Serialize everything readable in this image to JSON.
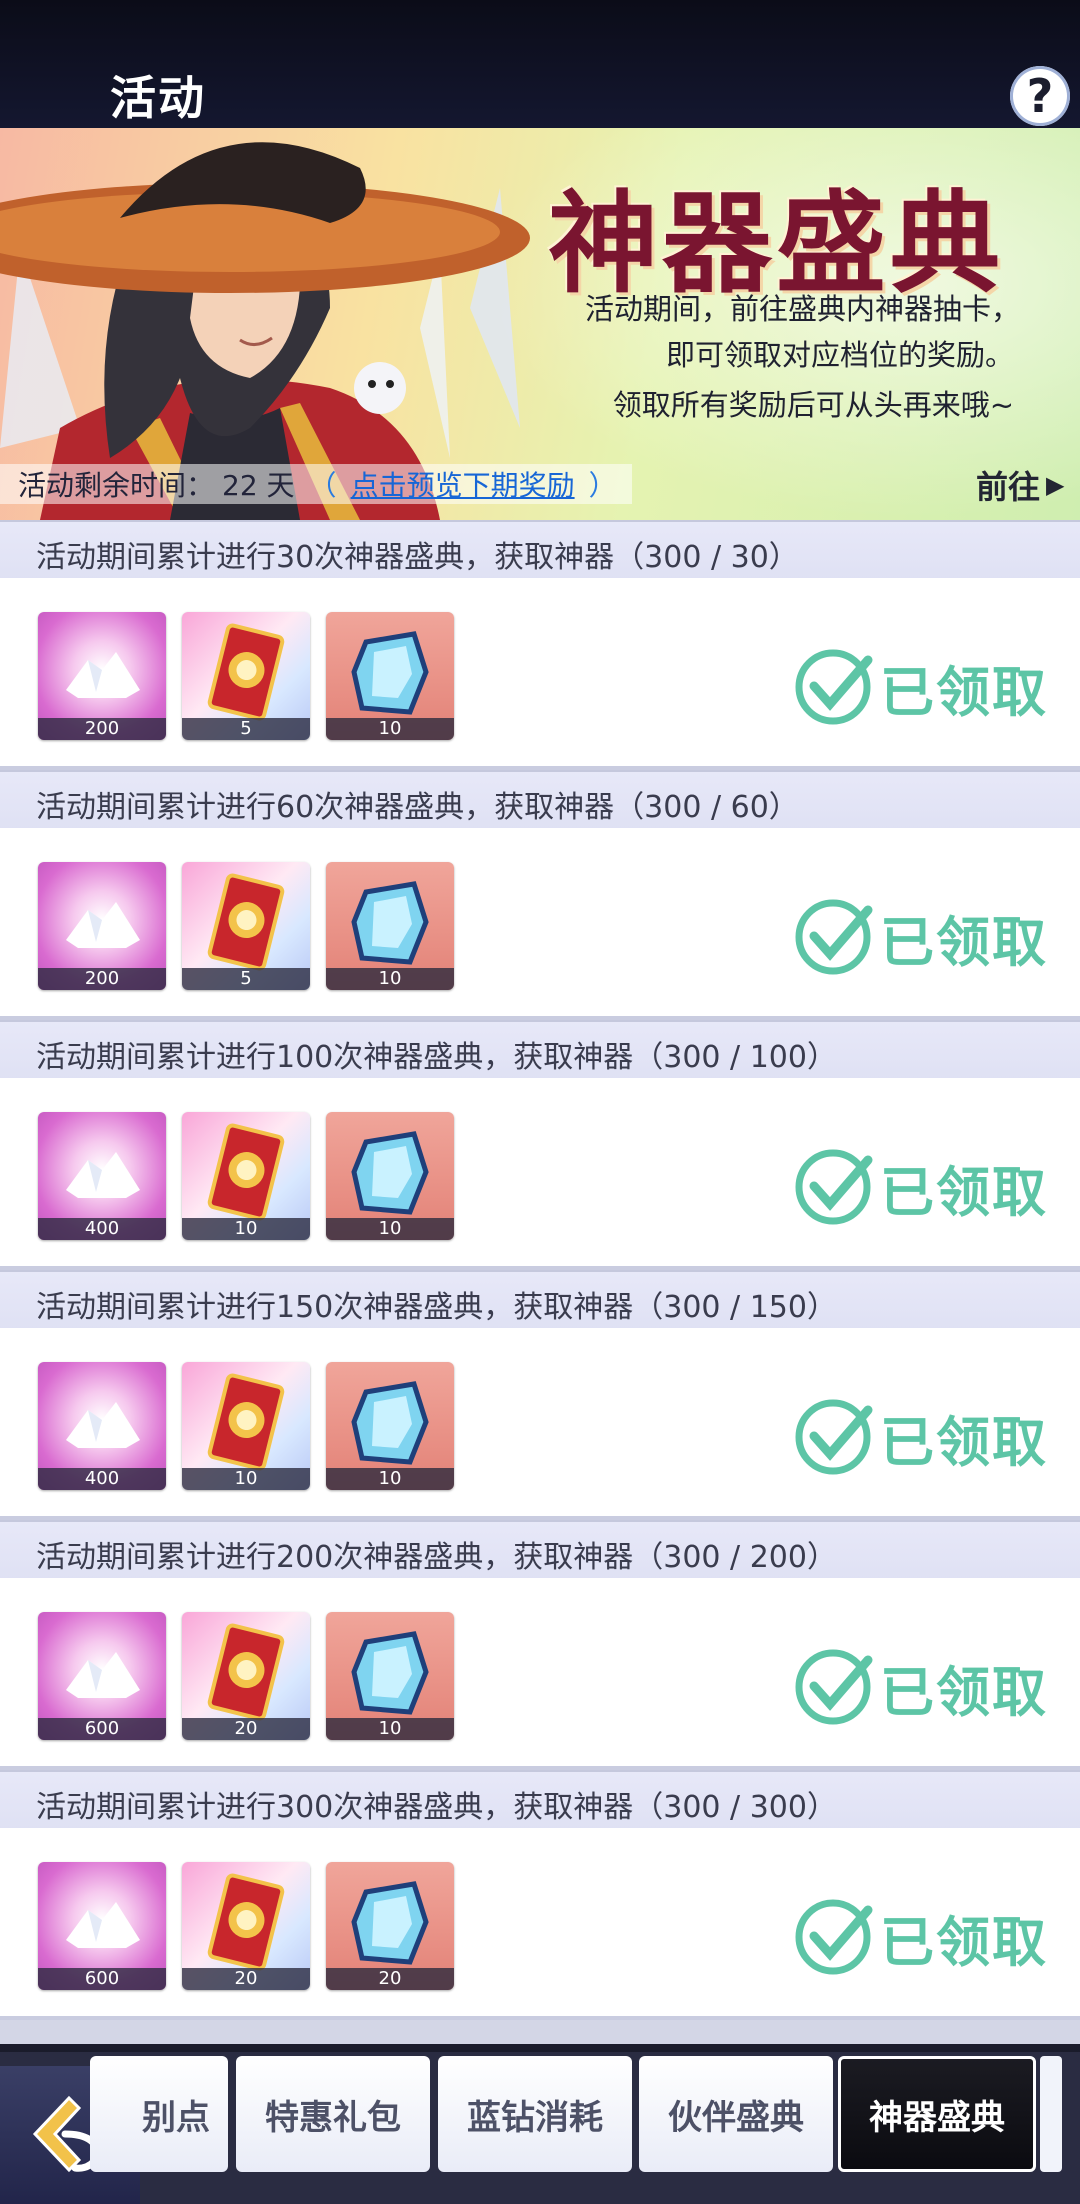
{
  "header": {
    "title": "活动",
    "help_icon": "help-icon"
  },
  "banner": {
    "title": "神器盛典",
    "desc_lines": [
      "活动期间，前往盛典内神器抽卡，",
      "即可领取对应档位的奖励。",
      "领取所有奖励后可从头再来哦~"
    ],
    "timer_label": "活动剩余时间：",
    "timer_value": "22 天",
    "paren_open": "（",
    "preview_link": "点击预览下期奖励",
    "paren_close": "）",
    "goto_label": "前往"
  },
  "tasks": [
    {
      "title": "活动期间累计进行30次神器盛典，获取神器（300 / 30）",
      "rewards": [
        "200",
        "5",
        "10"
      ],
      "status": "已领取"
    },
    {
      "title": "活动期间累计进行60次神器盛典，获取神器（300 / 60）",
      "rewards": [
        "200",
        "5",
        "10"
      ],
      "status": "已领取"
    },
    {
      "title": "活动期间累计进行100次神器盛典，获取神器（300 / 100）",
      "rewards": [
        "400",
        "10",
        "10"
      ],
      "status": "已领取"
    },
    {
      "title": "活动期间累计进行150次神器盛典，获取神器（300 / 150）",
      "rewards": [
        "400",
        "10",
        "10"
      ],
      "status": "已领取"
    },
    {
      "title": "活动期间累计进行200次神器盛典，获取神器（300 / 200）",
      "rewards": [
        "600",
        "20",
        "10"
      ],
      "status": "已领取"
    },
    {
      "title": "活动期间累计进行300次神器盛典，获取神器（300 / 300）",
      "rewards": [
        "600",
        "20",
        "20"
      ],
      "status": "已领取"
    }
  ],
  "nav": {
    "tabs": [
      "别点",
      "特惠礼包",
      "蓝钻消耗",
      "伙伴盛典",
      "神器盛典"
    ],
    "active_index": 4
  },
  "colors": {
    "accent_green": "#5dc5a6",
    "banner_title": "#7a1530",
    "link_blue": "#1766d6"
  }
}
